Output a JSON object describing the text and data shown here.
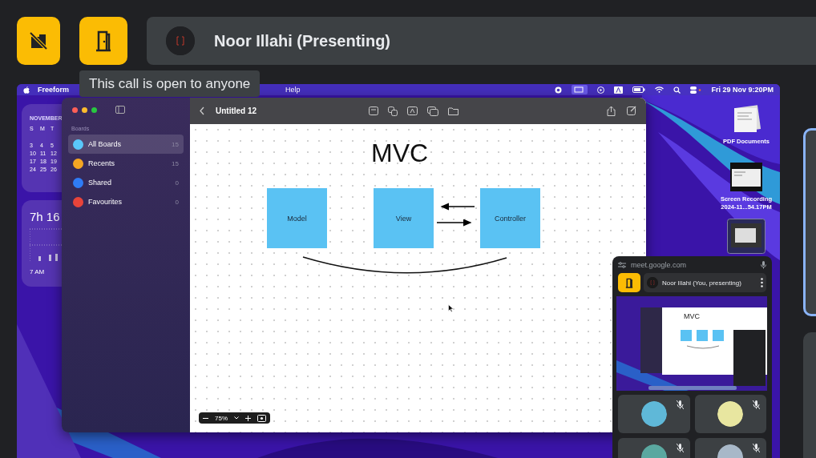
{
  "controls": [
    {
      "kind": "no-building"
    },
    {
      "kind": "door"
    }
  ],
  "presenter": {
    "name": "Noor Illahi (Presenting)"
  },
  "tooltip": "This call is open to anyone",
  "shared_screen": {
    "menu_bar": {
      "app": "Freeform",
      "items": [
        "Help"
      ],
      "clock": "Fri 29 Nov 9:20PM"
    },
    "calendar_widget": {
      "month": "NOVEMBER",
      "weekdays": [
        "S",
        "M",
        "T"
      ],
      "rows": [
        [
          "3",
          "4",
          "5"
        ],
        [
          "10",
          "11",
          "12"
        ],
        [
          "17",
          "18",
          "19"
        ],
        [
          "24",
          "25",
          "26"
        ]
      ]
    },
    "screen_time_widget": {
      "total": "7h 16",
      "axis_label": "7 AM"
    },
    "freeform": {
      "sidebar_heading": "Boards",
      "items": [
        {
          "label": "All Boards",
          "count": "15",
          "selected": true,
          "kind": "boards"
        },
        {
          "label": "Recents",
          "count": "15",
          "selected": false,
          "kind": "recents"
        },
        {
          "label": "Shared",
          "count": "0",
          "selected": false,
          "kind": "shared"
        },
        {
          "label": "Favourites",
          "count": "0",
          "selected": false,
          "kind": "favourites"
        }
      ],
      "board_title": "Untitled 12",
      "canvas_title": "MVC",
      "boxes": [
        "Model",
        "View",
        "Controller"
      ],
      "zoom": "75%"
    },
    "desktop_icons": [
      {
        "lines": [
          "PDF Documents"
        ],
        "kind": "documents"
      },
      {
        "lines": [
          "Screen Recording",
          "2024-11...54.17PM"
        ],
        "kind": "recording"
      },
      {
        "kind": "screenshot"
      }
    ]
  },
  "meet_window": {
    "address": "meet.google.com",
    "presenter": "Noor Illahi (You, presenting)",
    "preview_title": "MVC",
    "tiles": [
      {
        "muted": true,
        "color": "#5fb8d8"
      },
      {
        "muted": true,
        "color": "#e8e6a0"
      },
      {
        "muted": true,
        "color": "#5aa8a0"
      },
      {
        "muted": true,
        "color": "#a8b8c8"
      }
    ]
  }
}
